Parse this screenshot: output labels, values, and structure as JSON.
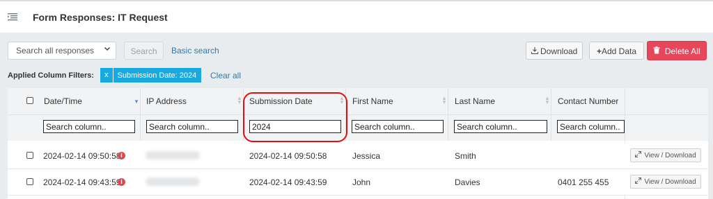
{
  "header": {
    "title": "Form Responses: IT Request"
  },
  "toolbar": {
    "search_select_value": "Search all responses",
    "search_button": "Search",
    "basic_search_link": "Basic search",
    "download_button": "Download",
    "add_data_button": "Add Data",
    "delete_all_button": "Delete All"
  },
  "filters": {
    "label": "Applied Column Filters:",
    "chips": [
      {
        "remove": "x",
        "text": "Submission Date: 2024"
      }
    ],
    "clear_all": "Clear all"
  },
  "table": {
    "columns": [
      {
        "label": "Date/Time",
        "search_value": "",
        "search_placeholder": "Search column.."
      },
      {
        "label": "IP Address",
        "search_value": "",
        "search_placeholder": "Search column.."
      },
      {
        "label": "Submission Date",
        "search_value": "2024",
        "search_placeholder": "Search column.."
      },
      {
        "label": "First Name",
        "search_value": "",
        "search_placeholder": "Search column.."
      },
      {
        "label": "Last Name",
        "search_value": "",
        "search_placeholder": "Search column.."
      },
      {
        "label": "Contact Number",
        "search_value": "",
        "search_placeholder": "Search column.."
      }
    ],
    "rows": [
      {
        "datetime": "2024-02-14 09:50:58",
        "submission_date": "2024-02-14 09:50:58",
        "first_name": "Jessica",
        "last_name": "Smith",
        "contact": "",
        "action": "View / Download"
      },
      {
        "datetime": "2024-02-14 09:43:59",
        "submission_date": "2024-02-14 09:43:59",
        "first_name": "John",
        "last_name": "Davies",
        "contact": "0401 255 455",
        "action": "View / Download"
      }
    ]
  },
  "colors": {
    "accent": "#17a9df",
    "danger": "#e8475b",
    "link": "#2a7ab0",
    "highlight": "#e10f0f"
  },
  "icons": [
    "menu-icon",
    "chevron-down-icon",
    "download-icon",
    "plus-icon",
    "trash-icon",
    "sort-icon",
    "info-icon",
    "expand-icon"
  ]
}
